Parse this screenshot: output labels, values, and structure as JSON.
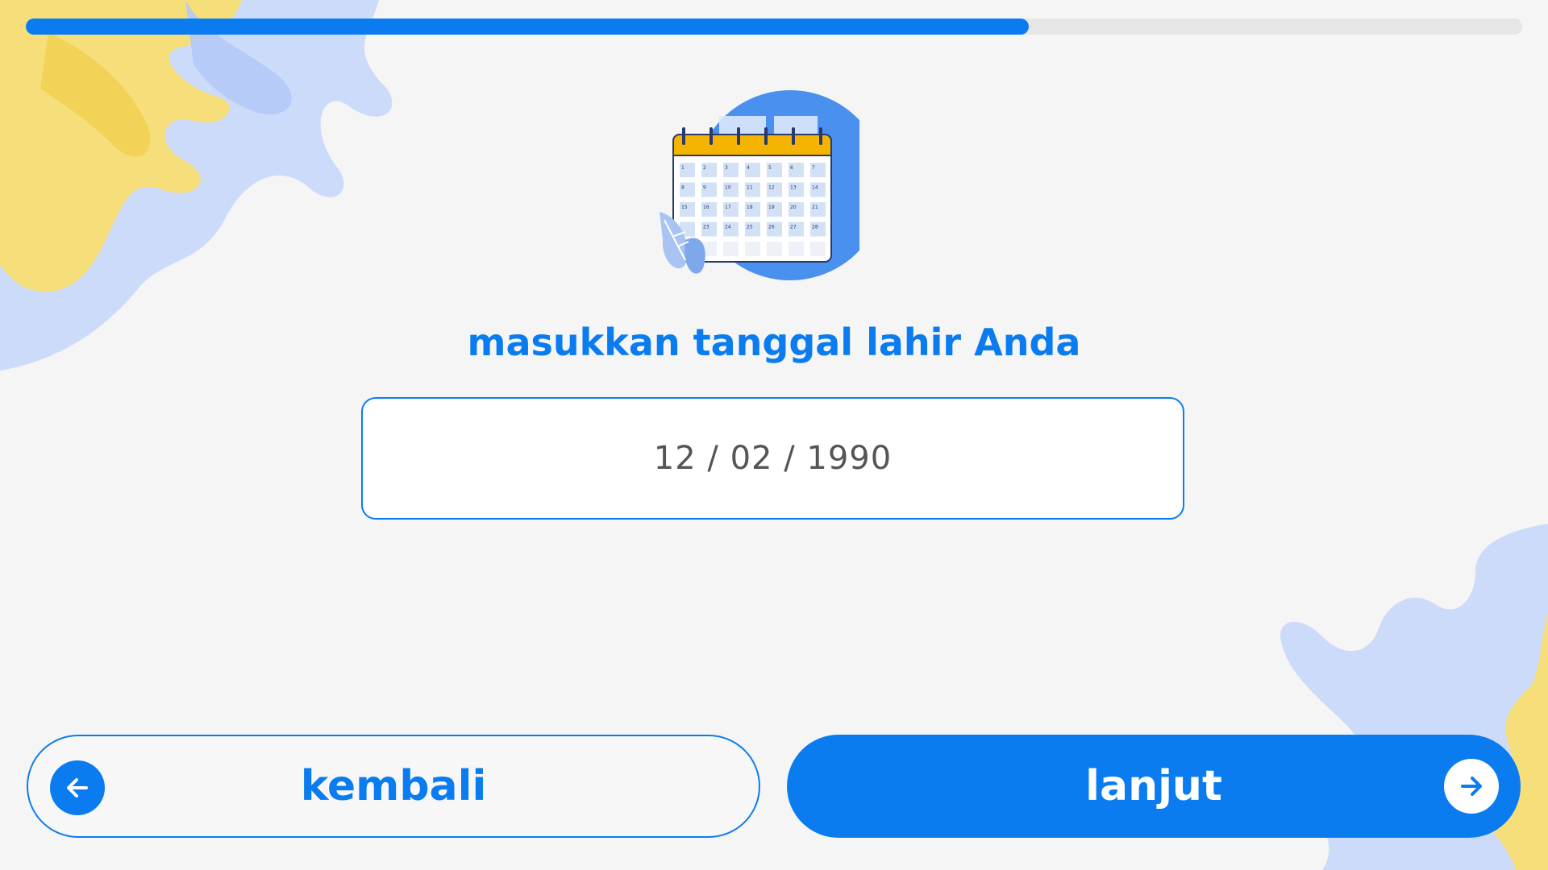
{
  "progress": {
    "percent": 67
  },
  "prompt": {
    "text": "masukkan tanggal lahir Anda"
  },
  "date_field": {
    "value": "12 / 02 / 1990"
  },
  "buttons": {
    "back_label": "kembali",
    "next_label": "lanjut"
  },
  "calendar": {
    "rows": [
      [
        "1",
        "2",
        "3",
        "4",
        "5",
        "6",
        "7"
      ],
      [
        "8",
        "9",
        "10",
        "11",
        "12",
        "13",
        "14"
      ],
      [
        "15",
        "16",
        "17",
        "18",
        "19",
        "20",
        "21"
      ],
      [
        "",
        "23",
        "24",
        "25",
        "26",
        "27",
        "28"
      ]
    ]
  },
  "icons": {
    "back": "arrow-left-icon",
    "next": "arrow-right-icon",
    "illustration": "calendar-icon"
  },
  "colors": {
    "accent": "#0a7cf0",
    "calendar_header": "#f5b400",
    "background": "#f5f5f5"
  }
}
